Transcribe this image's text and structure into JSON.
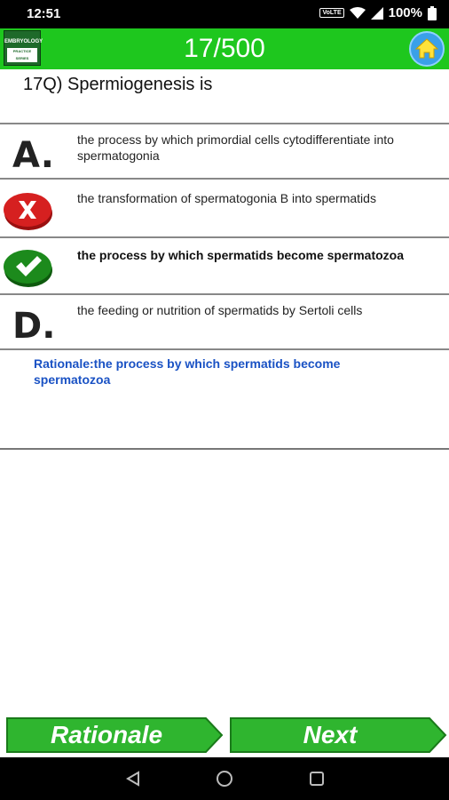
{
  "status_bar": {
    "time": "12:51",
    "volte": "VoLTE",
    "battery": "100%"
  },
  "app_bar": {
    "logo_title": "EMBRYOLOGY",
    "logo_sub": "PRACTICE SERIES",
    "counter": "17/500",
    "home_icon": "home-icon"
  },
  "question": {
    "text": "17Q) Spermiogenesis is"
  },
  "options": [
    {
      "marker": "A.",
      "text": "the process by which primordial cells cytodifferentiate into spermatogonia"
    },
    {
      "marker": "wrong-icon",
      "text": "the transformation of spermatogonia B into spermatids"
    },
    {
      "marker": "correct-icon",
      "text": "the process by which spermatids become spermatozoa"
    },
    {
      "marker": "D.",
      "text": "the feeding or nutrition of spermatids by Sertoli cells"
    }
  ],
  "rationale": {
    "text": "Rationale:the process by which spermatids become spermatozoa"
  },
  "buttons": {
    "rationale": "Rationale",
    "next": "Next"
  },
  "colors": {
    "app_green": "#1ec71e",
    "button_green": "#2fb52f",
    "rationale_blue": "#1a52c4",
    "wrong_red": "#d62020",
    "correct_green": "#1c8a1c"
  }
}
